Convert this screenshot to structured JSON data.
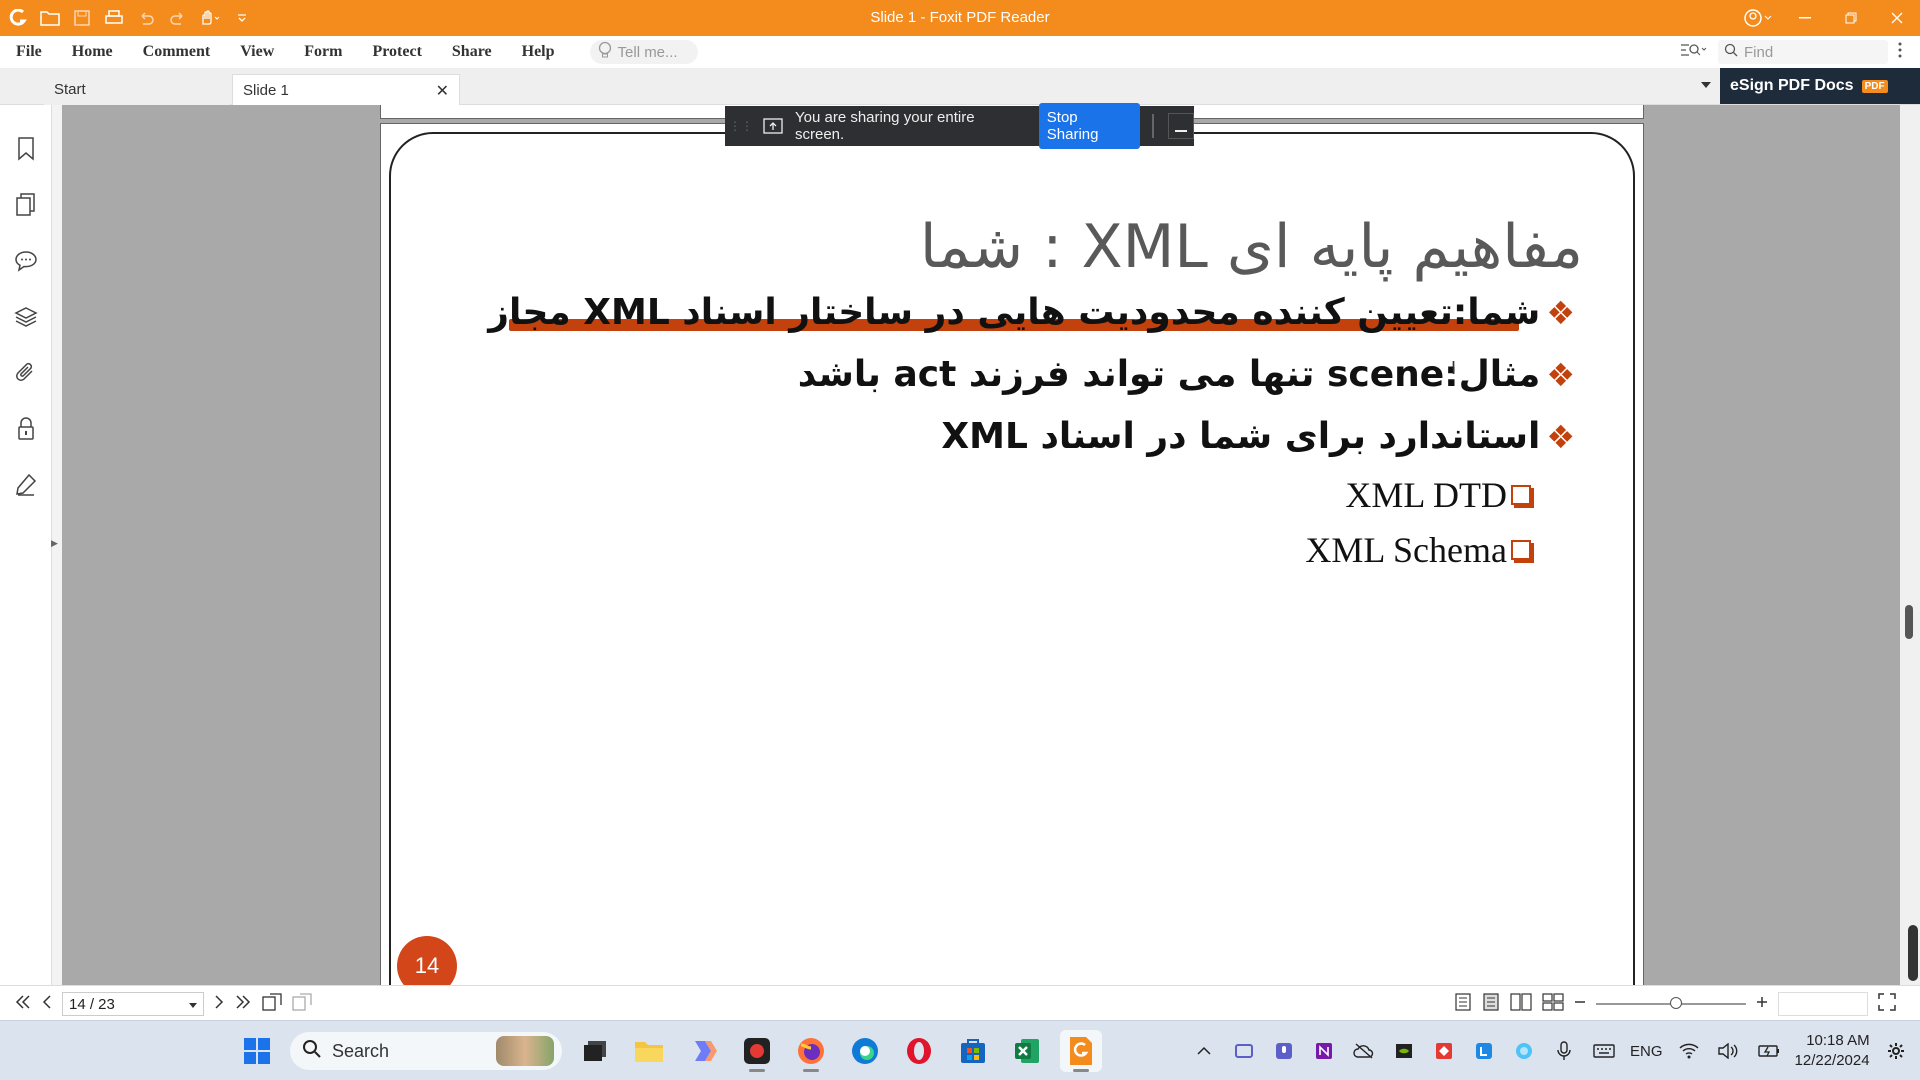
{
  "window": {
    "title": "Slide 1 - Foxit PDF Reader"
  },
  "menu": {
    "items": [
      "File",
      "Home",
      "Comment",
      "View",
      "Form",
      "Protect",
      "Share",
      "Help"
    ],
    "tell_me_placeholder": "Tell me...",
    "find_placeholder": "Find"
  },
  "tabs": [
    {
      "label": "Start"
    },
    {
      "label": "Slide 1"
    }
  ],
  "esign": {
    "label": "eSign PDF Docs",
    "badge": "PDF"
  },
  "sharing": {
    "message": "You are sharing your entire screen.",
    "stop_label": "Stop Sharing"
  },
  "slide": {
    "title": "مفاهیم پایه ای XML : شما",
    "bullets": [
      "شما:تعیین کننده محدودیت هایی در ساختار اسناد XML مجاز",
      "مثال:scene تنها می تواند فرزند act باشد",
      "استاندارد برای شما در اسناد XML"
    ],
    "sub_items": [
      "XML DTD",
      "XML Schema"
    ],
    "number": "14",
    "accent_color": "#c2410c"
  },
  "status": {
    "page_indicator": "14 / 23"
  },
  "taskbar": {
    "search_label": "Search",
    "language": "ENG",
    "time": "10:18 AM",
    "date": "12/22/2024"
  },
  "colors": {
    "titlebar": "#f38b1d",
    "share_button": "#1a73e8"
  }
}
